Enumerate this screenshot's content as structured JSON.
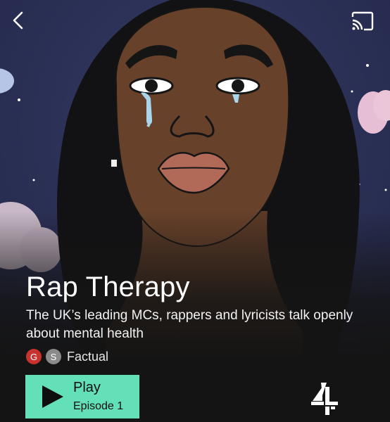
{
  "show": {
    "title": "Rap Therapy",
    "description": "The UK’s leading MCs, rappers and lyricists talk openly about mental health",
    "badges": [
      "G",
      "S"
    ],
    "genre": "Factual"
  },
  "play": {
    "label": "Play",
    "episode": "Episode 1"
  },
  "colors": {
    "play_button": "#63e0b7",
    "badge_g": "#c8322f",
    "badge_s": "#8a8a8a",
    "background": "#141414",
    "sky": "#2b3054"
  },
  "icons": {
    "back": "chevron-left-icon",
    "cast": "cast-icon",
    "play": "play-triangle-icon",
    "brand": "channel-4-logo"
  }
}
